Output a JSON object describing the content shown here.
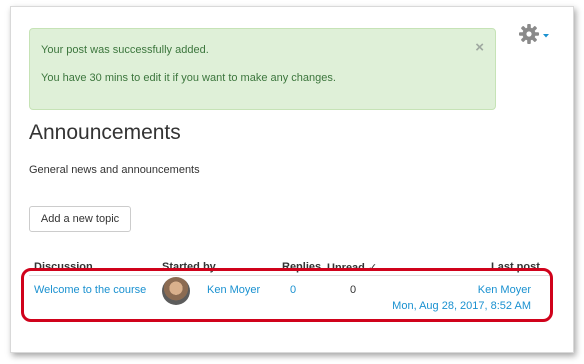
{
  "alert": {
    "message_line1": "Your post was successfully added.",
    "message_line2": "You have 30 mins to edit it if you want to make any changes.",
    "close_label": "×"
  },
  "forum": {
    "title": "Announcements",
    "description": "General news and announcements",
    "add_button_label": "Add a new topic"
  },
  "table": {
    "columns": {
      "discussion": "Discussion",
      "started_by": "Started by",
      "replies": "Replies",
      "unread": "Unread ✓",
      "last_post": "Last post"
    },
    "rows": [
      {
        "discussion": "Welcome to the course",
        "author": "Ken Moyer",
        "replies": "0",
        "unread": "0",
        "last_post_author": "Ken Moyer",
        "last_post_date": "Mon, Aug 28, 2017, 8:52 AM"
      }
    ]
  },
  "icons": {
    "settings": "gear-icon",
    "dropdown": "caret-down-icon",
    "avatar": "user-avatar"
  },
  "colors": {
    "link": "#1a91d0",
    "alert_bg": "#dff0d8",
    "alert_text": "#3c763d",
    "highlight": "#d0021b"
  }
}
